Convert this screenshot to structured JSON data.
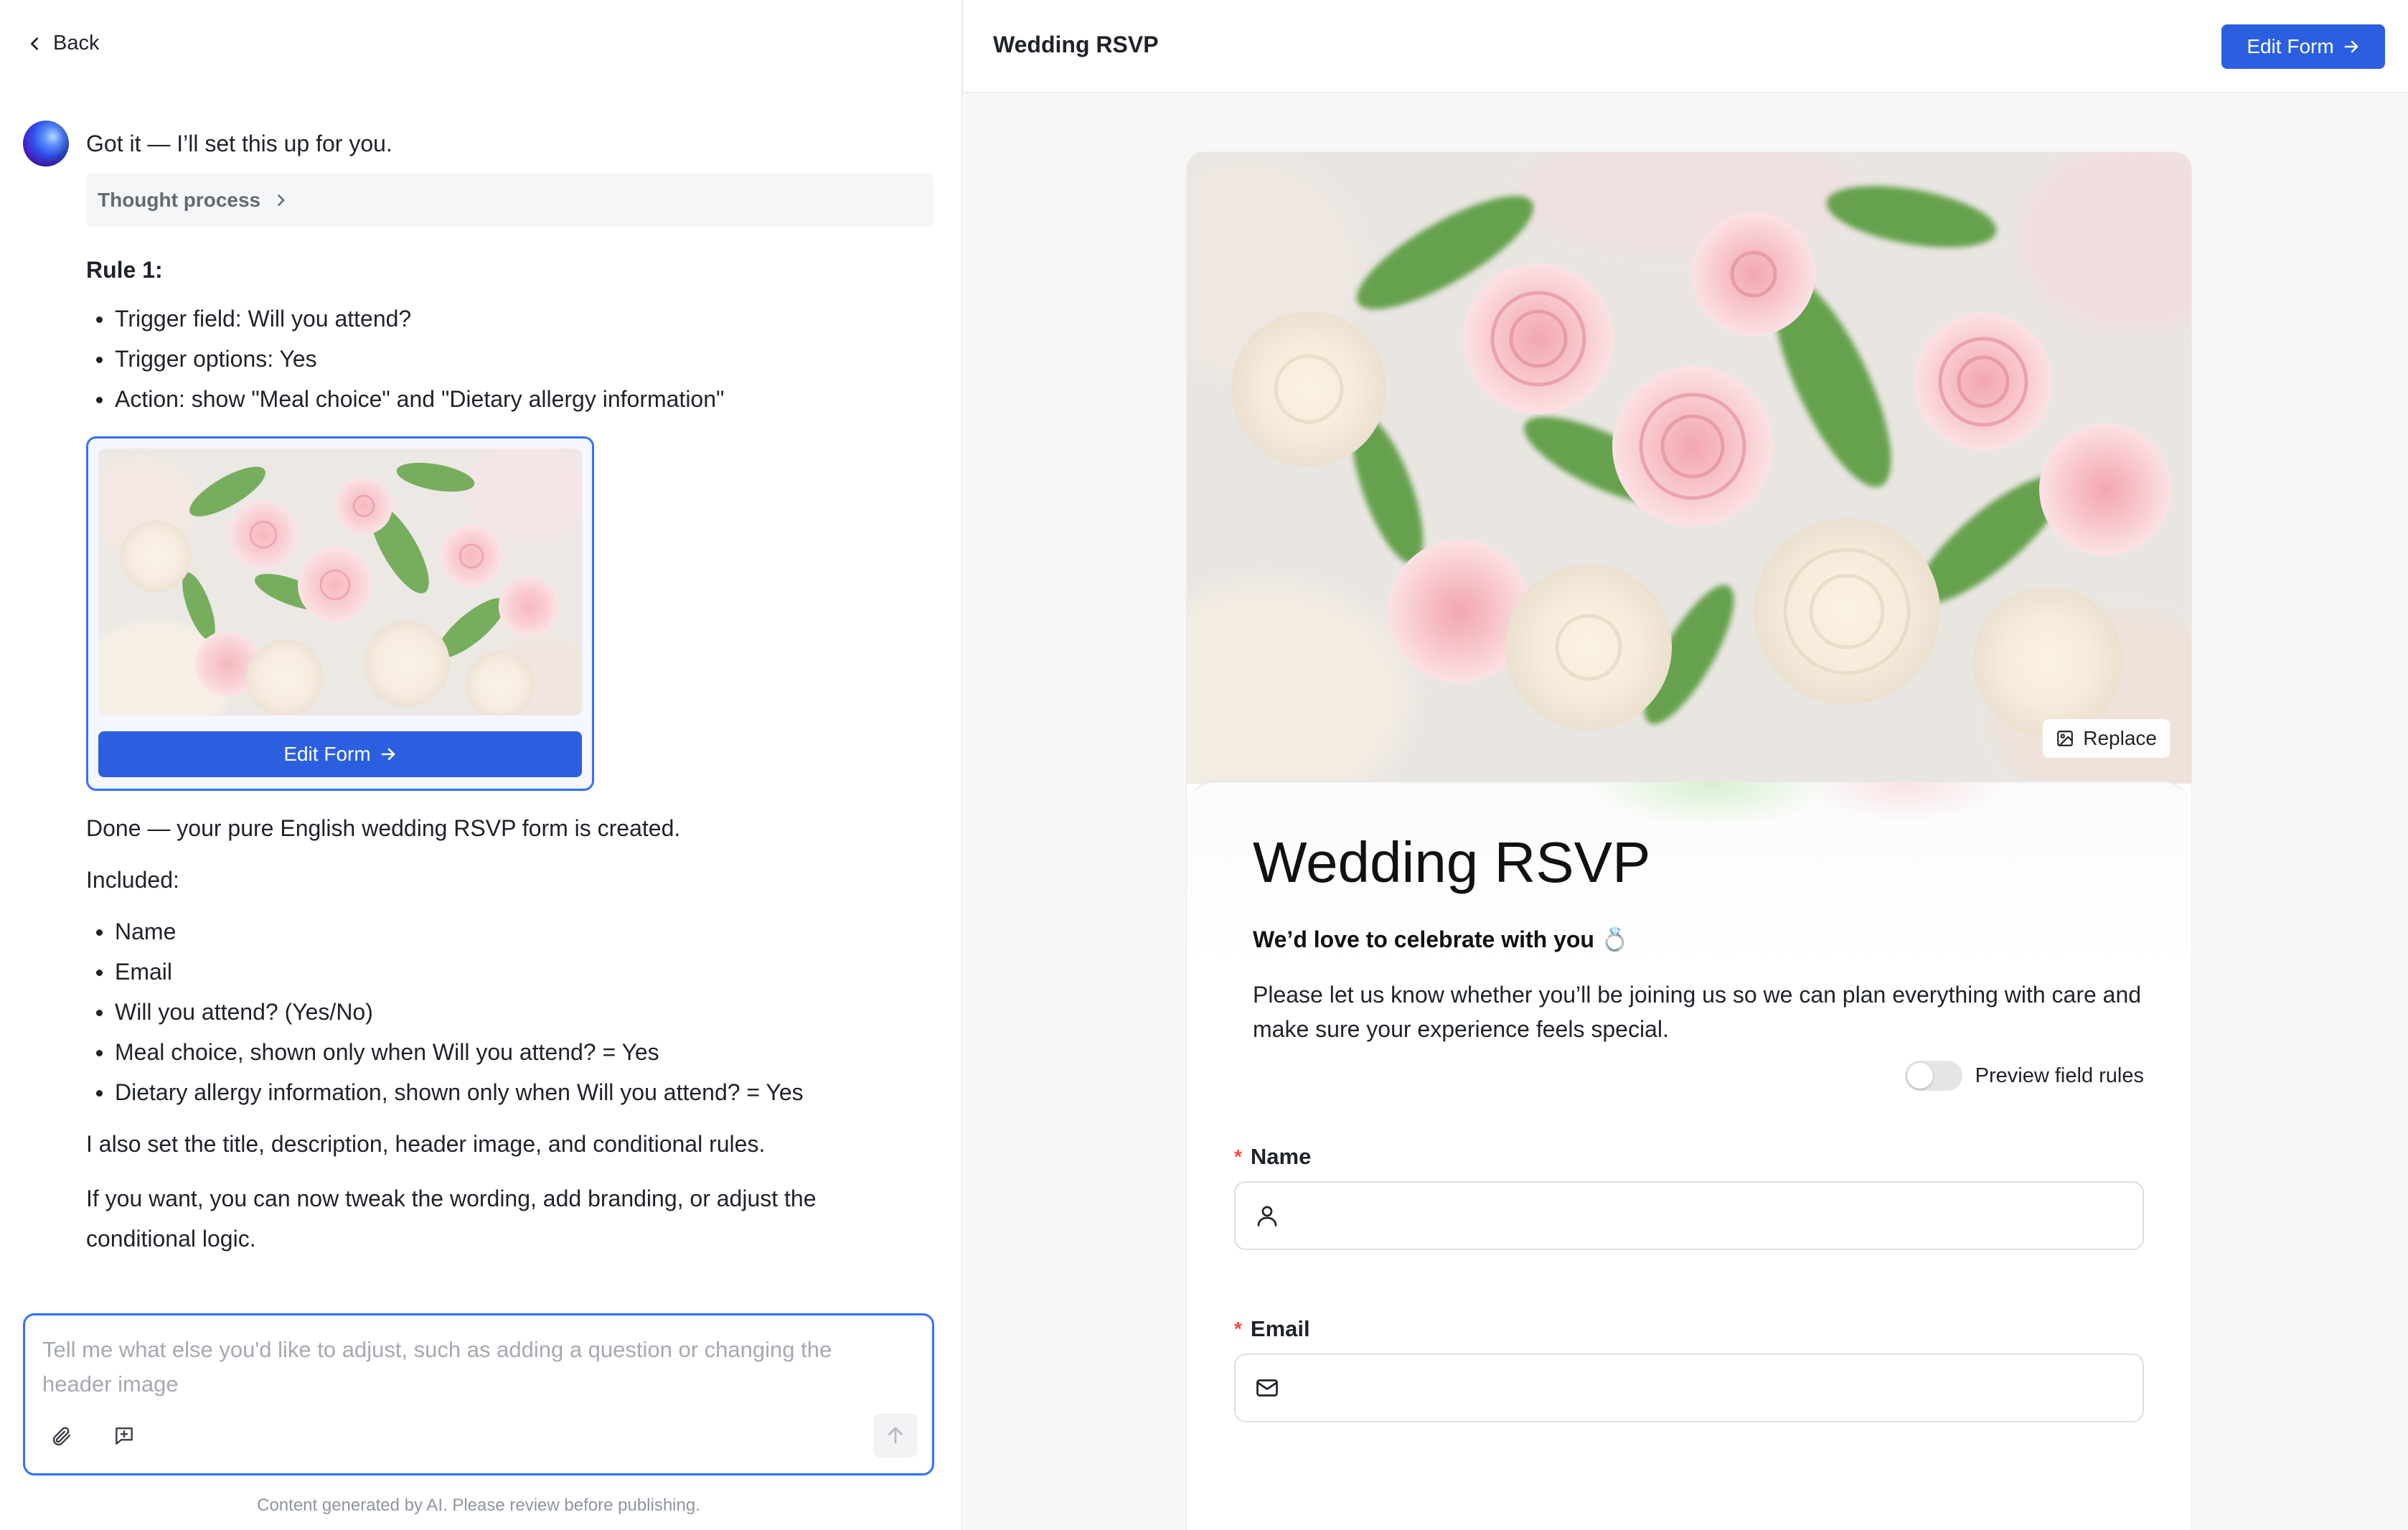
{
  "left": {
    "back_label": "Back",
    "greeting": "Got it — I’ll set this up for you.",
    "thought_label": "Thought process",
    "rule_title": "Rule 1:",
    "rule_items": [
      "Trigger field: Will you attend?",
      "Trigger options: Yes",
      "Action: show \"Meal choice\" and \"Dietary allergy information\""
    ],
    "card_button": "Edit Form",
    "done_text": "Done — your pure English wedding RSVP form is created.",
    "included_label": "Included:",
    "included_items": [
      "Name",
      "Email",
      "Will you attend? (Yes/No)",
      "Meal choice, shown only when Will you attend? = Yes",
      "Dietary allergy information, shown only when Will you attend? = Yes"
    ],
    "also_text": "I also set the title, description, header image, and conditional rules.",
    "ifyou_text": "If you want, you can now tweak the wording, add branding, or adjust the conditional logic.",
    "input_placeholder": "Tell me what else you'd like to adjust, such as adding a question or changing the header image",
    "disclaimer": "Content generated by AI. Please review before publishing."
  },
  "right": {
    "title": "Wedding RSVP",
    "edit_button": "Edit Form",
    "replace_label": "Replace",
    "form_title": "Wedding RSVP",
    "form_subtitle": "We’d love to celebrate with you 💍",
    "form_description": "Please let us know whether you’ll be joining us so we can plan everything with care and make sure your experience feels special.",
    "preview_rules_label": "Preview field rules",
    "preview_rules_on": false,
    "fields": [
      {
        "label": "Name",
        "required": true,
        "icon": "user-icon",
        "value": ""
      },
      {
        "label": "Email",
        "required": true,
        "icon": "mail-icon",
        "value": ""
      }
    ]
  },
  "colors": {
    "accent": "#2b5fe0",
    "accent_border": "#3370ff",
    "required": "#f54a45"
  }
}
